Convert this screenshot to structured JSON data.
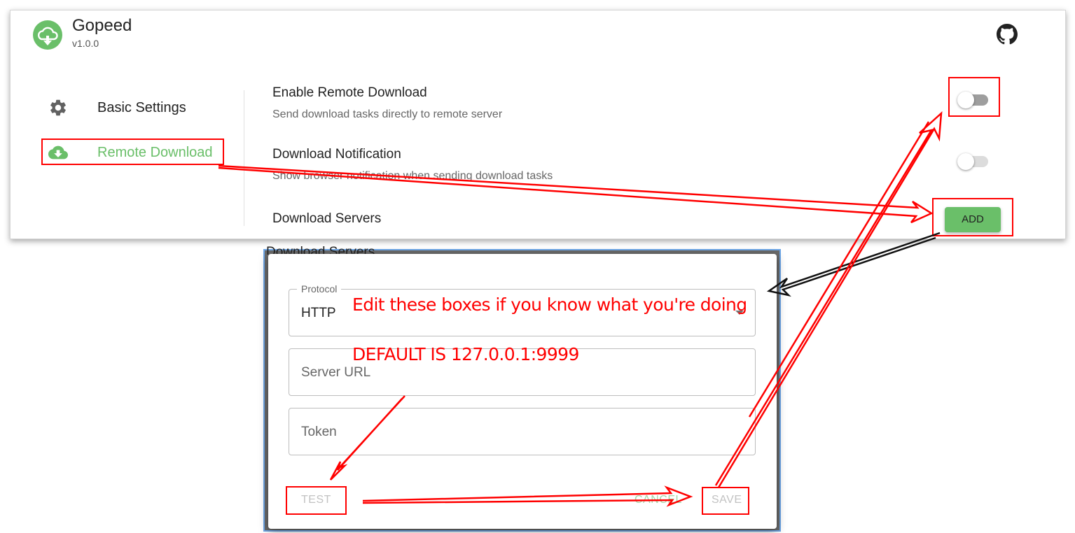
{
  "app": {
    "name": "Gopeed",
    "version": "v1.0.0",
    "logo_icon": "cloud-download-logo",
    "github_icon": "github-icon",
    "brand_color": "#6abf69"
  },
  "sidebar": {
    "items": [
      {
        "label": "Basic Settings",
        "icon": "gear-icon",
        "active": false
      },
      {
        "label": "Remote Download",
        "icon": "cloud-download-icon",
        "active": true
      }
    ]
  },
  "settings": {
    "enable_remote": {
      "title": "Enable Remote Download",
      "description": "Send download tasks directly to remote server",
      "enabled": false
    },
    "notification": {
      "title": "Download Notification",
      "description": "Show browser notification when sending download tasks",
      "enabled": false
    },
    "servers": {
      "title": "Download Servers",
      "add_label": "ADD"
    }
  },
  "dialog": {
    "behind_title": "Download Servers",
    "protocol": {
      "legend": "Protocol",
      "value": "HTTP"
    },
    "server_url": {
      "placeholder": "Server URL"
    },
    "token": {
      "placeholder": "Token"
    },
    "buttons": {
      "test": "TEST",
      "cancel": "CANCEL",
      "save": "SAVE"
    }
  },
  "annotations": {
    "edit_note": "Edit these boxes if you know what you're doing",
    "default_note": "DEFAULT IS   127.0.0.1:9999",
    "color": "#ff0000"
  }
}
